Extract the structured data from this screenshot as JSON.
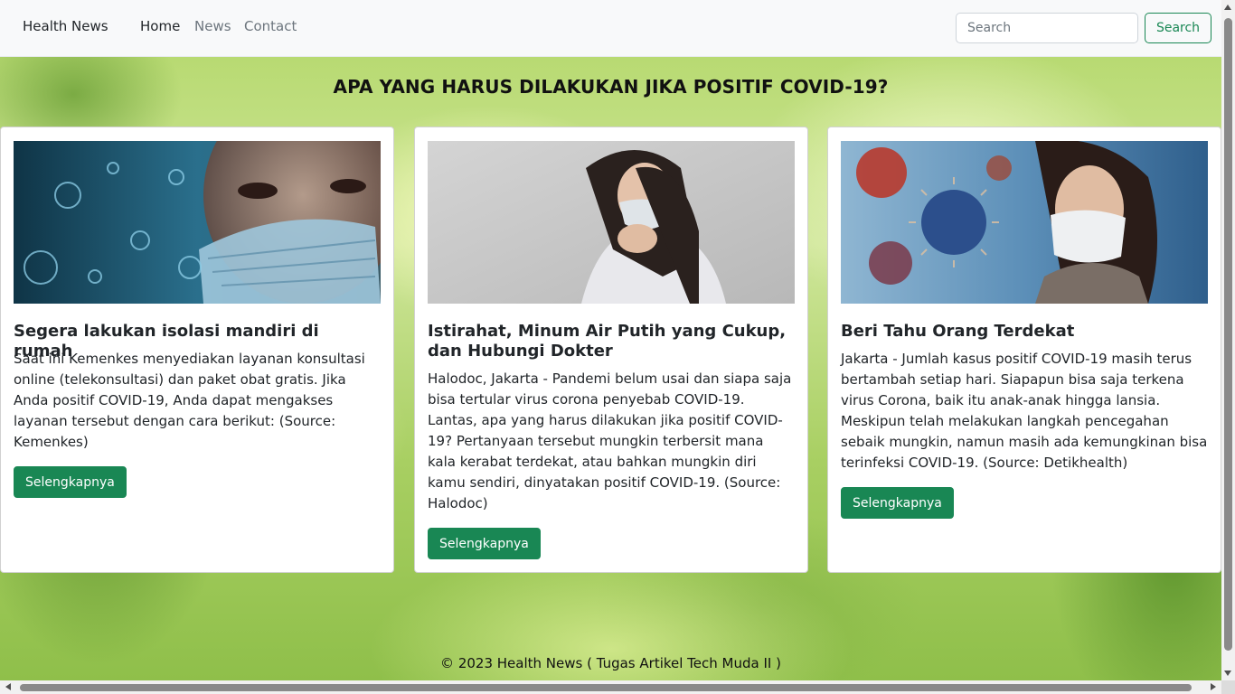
{
  "navbar": {
    "brand": "Health News",
    "links": [
      {
        "label": "Home",
        "active": true
      },
      {
        "label": "News",
        "active": false
      },
      {
        "label": "Contact",
        "active": false
      }
    ],
    "search": {
      "placeholder": "Search",
      "value": "",
      "button_label": "Search"
    }
  },
  "page": {
    "title": "APA YANG HARUS DILAKUKAN JIKA POSITIF COVID-19?"
  },
  "cards": [
    {
      "image": "woman-mask-virus-photo",
      "title": "Segera lakukan isolasi mandiri di rumah",
      "text": "Saat ini Kemenkes menyediakan layanan konsultasi online (telekonsultasi) dan paket obat gratis. Jika Anda positif COVID-19, Anda dapat mengakses layanan tersebut dengan cara berikut: (Source: Kemenkes)",
      "button_label": "Selengkapnya"
    },
    {
      "image": "woman-coughing-mask-photo",
      "title": "Istirahat, Minum Air Putih yang Cukup, dan Hubungi Dokter",
      "text": "Halodoc, Jakarta - Pandemi belum usai dan siapa saja bisa tertular virus corona penyebab COVID-19. Lantas, apa yang harus dilakukan jika positif COVID-19? Pertanyaan tersebut mungkin terbersit mana kala kerabat terdekat, atau bahkan mungkin diri kamu sendiri, dinyatakan positif COVID-19. (Source: Halodoc)",
      "button_label": "Selengkapnya"
    },
    {
      "image": "woman-mask-coronavirus-photo",
      "title": "Beri Tahu Orang Terdekat",
      "text": "Jakarta - Jumlah kasus positif COVID-19 masih terus bertambah setiap hari. Siapapun bisa saja terkena virus Corona, baik itu anak-anak hingga lansia. Meskipun telah melakukan langkah pencegahan sebaik mungkin, namun masih ada kemungkinan bisa terinfeksi COVID-19. (Source: Detikhealth)",
      "button_label": "Selengkapnya"
    }
  ],
  "footer": {
    "text": "© 2023 Health News ( Tugas Artikel Tech Muda II )"
  },
  "colors": {
    "accent": "#198754",
    "navbar_bg": "#f8f9fa",
    "nav_muted": "#6c757d"
  }
}
